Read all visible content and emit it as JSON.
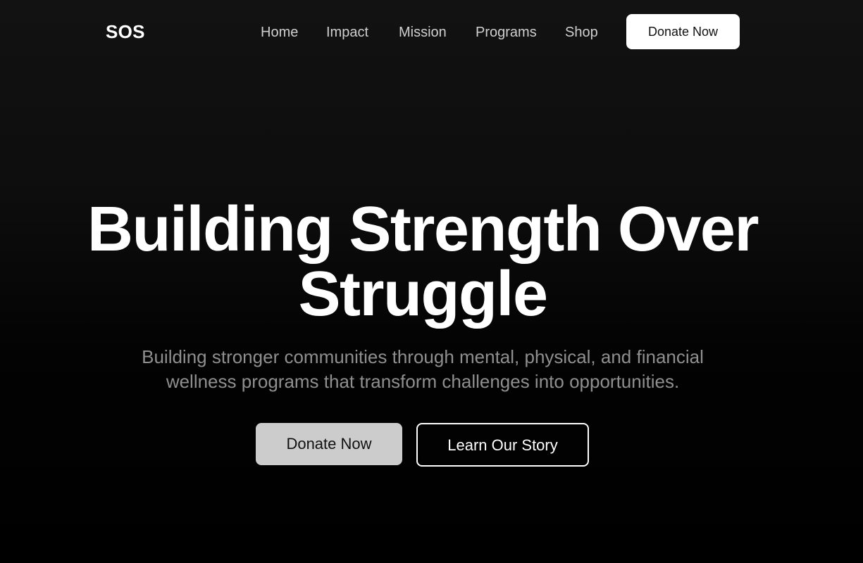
{
  "nav": {
    "logo": "SOS",
    "links": [
      "Home",
      "Impact",
      "Mission",
      "Programs",
      "Shop"
    ],
    "donate_label": "Donate Now"
  },
  "hero": {
    "title_line1": "Building Strength Over",
    "title_line2": "Struggle",
    "subtitle_line1": "Building stronger communities through mental, physical, and financial",
    "subtitle_line2": "wellness programs that transform challenges into opportunities.",
    "primary_cta": "Donate Now",
    "secondary_cta": "Learn Our Story"
  },
  "colors": {
    "background_top": "#121212",
    "background_bottom": "#000000",
    "nav_text": "#cfcfcf",
    "subtitle_text": "#8f8f8f",
    "primary_button_bg": "#cccccc",
    "nav_donate_bg": "#ffffff"
  }
}
